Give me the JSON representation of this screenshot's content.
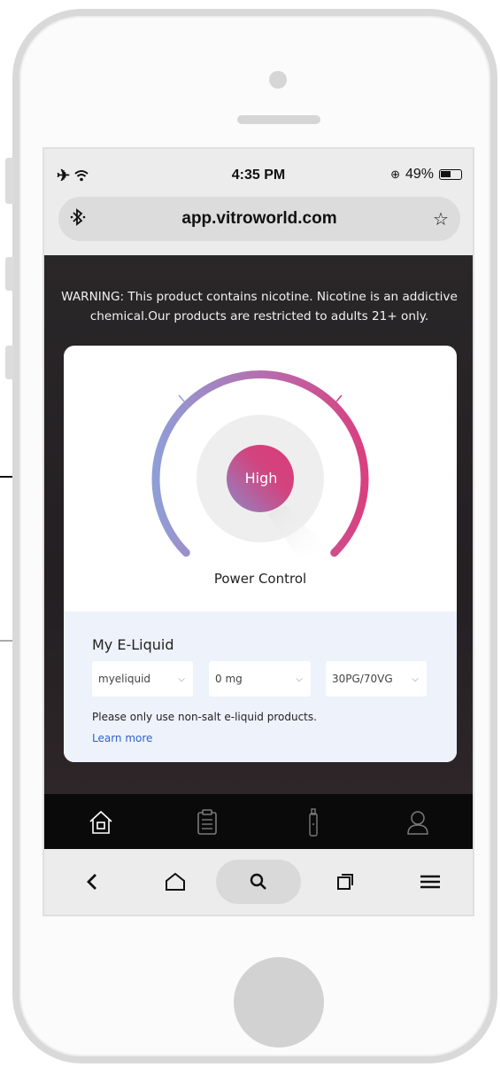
{
  "status_bar": {
    "left_icons": "✈ wifi",
    "time": "4:35 PM",
    "battery_text": "49%"
  },
  "browser": {
    "url": "app.vitroworld.com",
    "left_icon": "bluetooth-icon",
    "right_icon": "star-icon"
  },
  "page": {
    "warning": "WARNING: This product contains nicotine. Nicotine is an addictive chemical.Our products are restricted to adults 21+ only.",
    "power": {
      "level": "High",
      "label": "Power Control"
    },
    "eliquid": {
      "title": "My E-Liquid",
      "flavor": "myeliquid",
      "strength": "0 mg",
      "ratio": "30PG/70VG",
      "note": "Please only use non-salt e-liquid products.",
      "learn_more": "Learn more"
    }
  },
  "tab_bar": [
    "home-icon",
    "clipboard-icon",
    "device-icon",
    "user-icon"
  ],
  "nav_bar": [
    "back-icon",
    "home-icon",
    "search-icon",
    "tabs-icon",
    "menu-icon"
  ],
  "colors": {
    "gauge_start": "#8f9ed6",
    "gauge_end": "#d9407f",
    "link": "#2e62c7",
    "panel": "#eef2fb"
  }
}
